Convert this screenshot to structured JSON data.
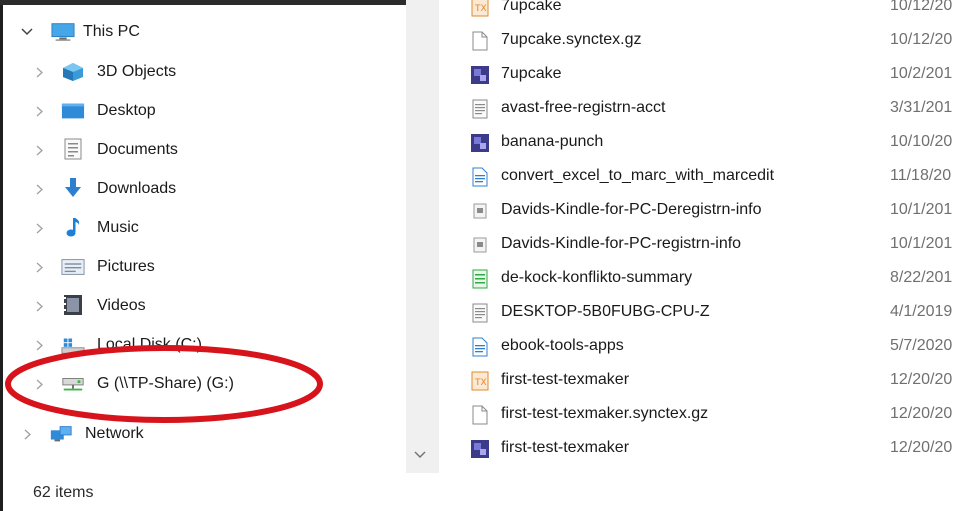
{
  "nav": {
    "items": [
      {
        "label": "This PC",
        "icon": "monitor-icon",
        "expanded": true
      },
      {
        "label": "3D Objects",
        "icon": "cube-icon"
      },
      {
        "label": "Desktop",
        "icon": "desktop-folder-icon"
      },
      {
        "label": "Documents",
        "icon": "documents-icon"
      },
      {
        "label": "Downloads",
        "icon": "download-arrow-icon"
      },
      {
        "label": "Music",
        "icon": "music-note-icon"
      },
      {
        "label": "Pictures",
        "icon": "pictures-icon"
      },
      {
        "label": "Videos",
        "icon": "videos-icon"
      },
      {
        "label": "Local Disk (C:)",
        "icon": "local-disk-icon"
      },
      {
        "label": "G (\\\\TP-Share) (G:)",
        "icon": "network-drive-icon"
      },
      {
        "label": "Network",
        "icon": "network-icon"
      }
    ]
  },
  "files": [
    {
      "name": "7upcake",
      "date": "10/12/20",
      "icon": "tex-file-icon"
    },
    {
      "name": "7upcake.synctex.gz",
      "date": "10/12/20",
      "icon": "blank-file-icon"
    },
    {
      "name": "7upcake",
      "date": "10/2/201",
      "icon": "app-file-icon"
    },
    {
      "name": "avast-free-registrn-acct",
      "date": "3/31/201",
      "icon": "text-file-icon"
    },
    {
      "name": "banana-punch",
      "date": "10/10/20",
      "icon": "app-file-icon"
    },
    {
      "name": "convert_excel_to_marc_with_marcedit",
      "date": "11/18/20",
      "icon": "doc-file-icon"
    },
    {
      "name": "Davids-Kindle-for-PC-Deregistrn-info",
      "date": "10/1/201",
      "icon": "small-doc-icon"
    },
    {
      "name": "Davids-Kindle-for-PC-registrn-info",
      "date": "10/1/201",
      "icon": "small-doc-icon"
    },
    {
      "name": "de-kock-konflikto-summary",
      "date": "8/22/201",
      "icon": "green-doc-icon"
    },
    {
      "name": "DESKTOP-5B0FUBG-CPU-Z",
      "date": "4/1/2019",
      "icon": "text-file-icon"
    },
    {
      "name": "ebook-tools-apps",
      "date": "5/7/2020",
      "icon": "doc-file-icon"
    },
    {
      "name": "first-test-texmaker",
      "date": "12/20/20",
      "icon": "tex-file-icon"
    },
    {
      "name": "first-test-texmaker.synctex.gz",
      "date": "12/20/20",
      "icon": "blank-file-icon"
    },
    {
      "name": "first-test-texmaker",
      "date": "12/20/20",
      "icon": "app-file-icon"
    }
  ],
  "status": {
    "item_count": "62 items"
  },
  "colors": {
    "highlight_ellipse": "#d7141b",
    "folder_blue": "#2f8ad8",
    "selection_blue": "#cce8ff"
  }
}
